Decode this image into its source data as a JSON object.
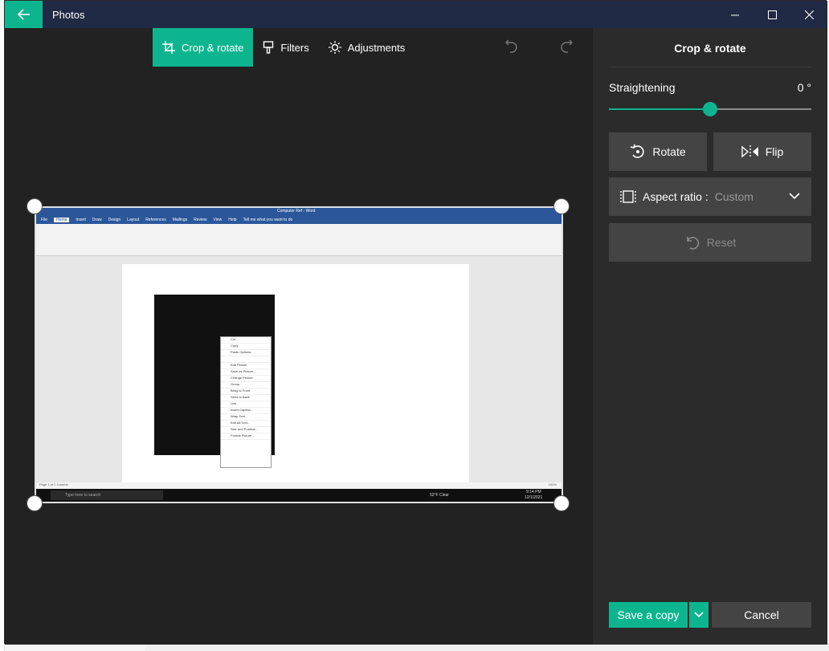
{
  "window": {
    "title": "Photos",
    "accent": "#0db58f",
    "titlebar_color": "#202a45"
  },
  "toolbar": {
    "crop_rotate_label": "Crop & rotate",
    "filters_label": "Filters",
    "adjustments_label": "Adjustments"
  },
  "photo": {
    "word_title": "Computer Ref - Word",
    "ribbon_tabs": [
      "File",
      "Home",
      "Insert",
      "Draw",
      "Design",
      "Layout",
      "References",
      "Mailings",
      "Review",
      "View",
      "Help"
    ],
    "tell_me": "Tell me what you want to do",
    "status_left": "Page 1 of 1    0 words",
    "zoom": "100%",
    "taskbar_search": "Type here to search",
    "taskbar_weather": "52°F  Clear",
    "taskbar_time": "9:14 PM",
    "taskbar_date": "12/1/2021",
    "context_menu": [
      "Cut",
      "Copy",
      "Paste Options:",
      "",
      "Edit Picture",
      "Save as Picture...",
      "Change Picture",
      "Group",
      "Bring to Front",
      "Send to Back",
      "Link",
      "Insert Caption...",
      "Wrap Text",
      "Edit Alt Text...",
      "Size and Position...",
      "Format Picture..."
    ]
  },
  "panel": {
    "heading": "Crop & rotate",
    "straightening_label": "Straightening",
    "straightening_value": "0 °",
    "straightening_fraction": 0.5,
    "rotate_label": "Rotate",
    "flip_label": "Flip",
    "aspect_label": "Aspect ratio :",
    "aspect_value": "Custom",
    "reset_label": "Reset",
    "save_label": "Save a copy",
    "cancel_label": "Cancel"
  }
}
